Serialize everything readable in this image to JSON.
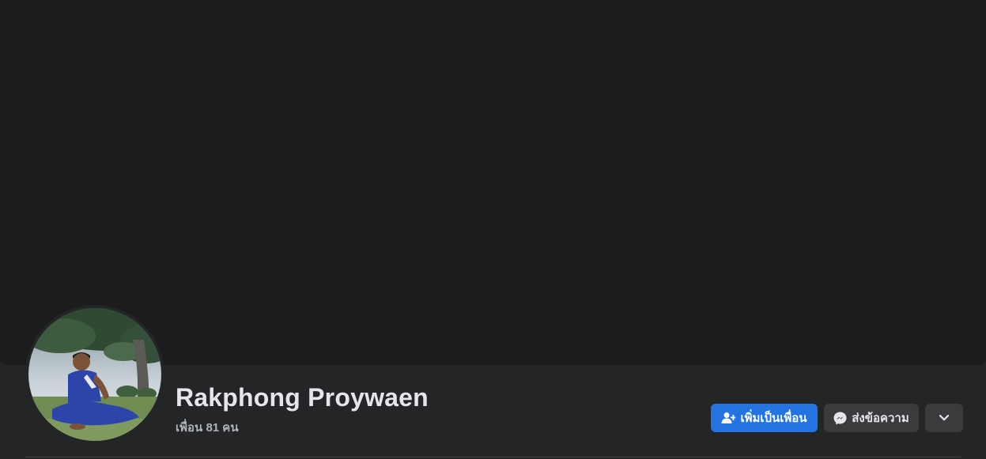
{
  "profile": {
    "name": "Rakphong Proywaen",
    "friends_count": "เพื่อน 81 คน"
  },
  "actions": {
    "add_friend_label": "เพิ่มเป็นเพื่อน",
    "message_label": "ส่งข้อความ"
  },
  "icons": {
    "add_friend": "person-plus-icon",
    "message": "messenger-icon",
    "more": "chevron-down-icon"
  },
  "colors": {
    "primary_button": "#2374e1",
    "secondary_button": "#3a3b3c",
    "page_background": "#242526",
    "cover_background": "#1b1c1e"
  }
}
